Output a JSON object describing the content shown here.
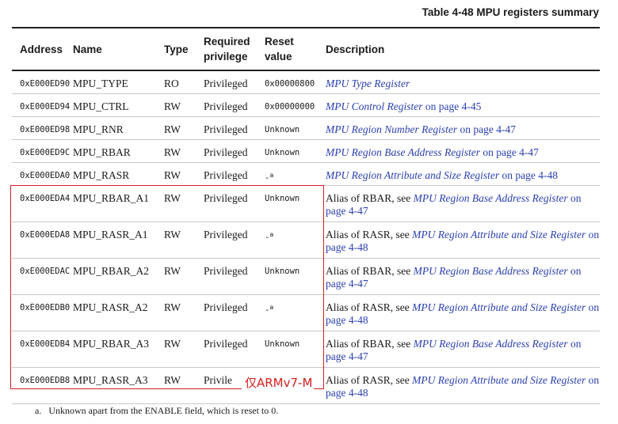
{
  "caption": "Table 4-48 MPU registers summary",
  "headers": {
    "address": "Address",
    "name": "Name",
    "type": "Type",
    "privilege": "Required privilege",
    "reset": "Reset value",
    "description": "Description"
  },
  "rows": [
    {
      "address": "0xE000ED90",
      "name": "MPU_TYPE",
      "type": "RO",
      "privilege": "Privileged",
      "reset": "0x00000800",
      "desc_prefix": "",
      "desc_link": "MPU Type Register",
      "desc_suffix": ""
    },
    {
      "address": "0xE000ED94",
      "name": "MPU_CTRL",
      "type": "RW",
      "privilege": "Privileged",
      "reset": "0x00000000",
      "desc_prefix": "",
      "desc_link": "MPU Control Register",
      "desc_suffix": " on page 4-45"
    },
    {
      "address": "0xE000ED98",
      "name": "MPU_RNR",
      "type": "RW",
      "privilege": "Privileged",
      "reset": "Unknown",
      "desc_prefix": "",
      "desc_link": "MPU Region Number Register",
      "desc_suffix": " on page 4-47"
    },
    {
      "address": "0xE000ED9C",
      "name": "MPU_RBAR",
      "type": "RW",
      "privilege": "Privileged",
      "reset": "Unknown",
      "desc_prefix": "",
      "desc_link": "MPU Region Base Address Register",
      "desc_suffix": " on page 4-47"
    },
    {
      "address": "0xE000EDA0",
      "name": "MPU_RASR",
      "type": "RW",
      "privilege": "Privileged",
      "reset": "-",
      "reset_note": "a",
      "desc_prefix": "",
      "desc_link": "MPU Region Attribute and Size Register",
      "desc_suffix": " on page 4-48"
    },
    {
      "address": "0xE000EDA4",
      "name": "MPU_RBAR_A1",
      "type": "RW",
      "privilege": "Privileged",
      "reset": "Unknown",
      "desc_prefix": "Alias of RBAR, see ",
      "desc_link": "MPU Region Base Address Register",
      "desc_suffix": " on page 4-47"
    },
    {
      "address": "0xE000EDA8",
      "name": "MPU_RASR_A1",
      "type": "RW",
      "privilege": "Privileged",
      "reset": "-",
      "reset_note": "a",
      "desc_prefix": "Alias of RASR, see ",
      "desc_link": "MPU Region Attribute and Size Register",
      "desc_suffix": " on page 4-48"
    },
    {
      "address": "0xE000EDAC",
      "name": "MPU_RBAR_A2",
      "type": "RW",
      "privilege": "Privileged",
      "reset": "Unknown",
      "desc_prefix": "Alias of RBAR, see ",
      "desc_link": "MPU Region Base Address Register",
      "desc_suffix": " on page 4-47"
    },
    {
      "address": "0xE000EDB0",
      "name": "MPU_RASR_A2",
      "type": "RW",
      "privilege": "Privileged",
      "reset": "-",
      "reset_note": "a",
      "desc_prefix": "Alias of RASR, see ",
      "desc_link": "MPU Region Attribute and Size Register",
      "desc_suffix": " on page 4-48"
    },
    {
      "address": "0xE000EDB4",
      "name": "MPU_RBAR_A3",
      "type": "RW",
      "privilege": "Privileged",
      "reset": "Unknown",
      "desc_prefix": "Alias of RBAR, see ",
      "desc_link": "MPU Region Base Address Register",
      "desc_suffix": " on page 4-47"
    },
    {
      "address": "0xE000EDB8",
      "name": "MPU_RASR_A3",
      "type": "RW",
      "privilege": "Privile",
      "reset": "",
      "desc_prefix": "Alias of RASR, see ",
      "desc_link": "MPU Region Attribute and Size Register",
      "desc_suffix": " on page 4-48"
    }
  ],
  "annotation": "仅ARMv7-M",
  "footnote": "a.   Unknown apart from the ENABLE field, which is reset to 0.",
  "colors": {
    "link": "#2a3fb0",
    "highlight_box": "#d42020"
  }
}
